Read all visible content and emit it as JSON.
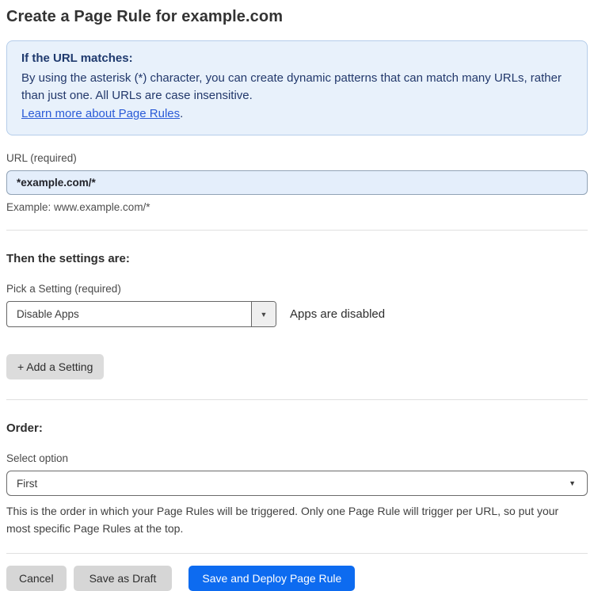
{
  "page": {
    "title": "Create a Page Rule for example.com"
  },
  "info_box": {
    "heading": "If the URL matches:",
    "body": "By using the asterisk (*) character, you can create dynamic patterns that can match many URLs, rather than just one. All URLs are case insensitive.",
    "link": "Learn more about Page Rules",
    "link_suffix": "."
  },
  "url_field": {
    "label": "URL (required)",
    "value": "*example.com/*",
    "helper": "Example: www.example.com/*"
  },
  "settings_section": {
    "heading": "Then the settings are:",
    "setting_label": "Pick a Setting (required)",
    "setting_value": "Disable Apps",
    "setting_status": "Apps are disabled",
    "add_setting_label": "+ Add a Setting"
  },
  "order_section": {
    "heading": "Order:",
    "select_label": "Select option",
    "select_value": "First",
    "helper": "This is the order in which your Page Rules will be triggered. Only one Page Rule will trigger per URL, so put your most specific Page Rules at the top."
  },
  "footer": {
    "cancel_label": "Cancel",
    "save_draft_label": "Save as Draft",
    "save_deploy_label": "Save and Deploy Page Rule"
  },
  "icons": {
    "dropdown_caret": "▼"
  },
  "colors": {
    "accent_blue": "#0d6bf0",
    "info_box_bg": "#e8f1fb",
    "info_box_border": "#b5cdea",
    "info_text": "#22386b",
    "link_blue": "#2a5bd7",
    "url_input_bg": "#e4eefb",
    "gray_button_bg": "#d6d6d6"
  }
}
